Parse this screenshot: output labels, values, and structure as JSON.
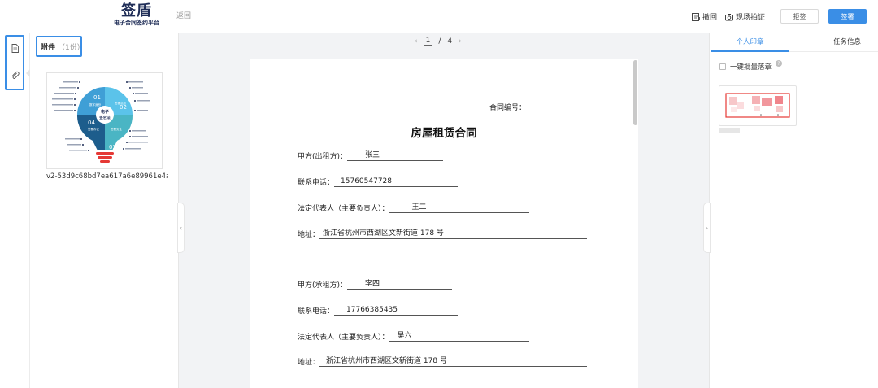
{
  "header": {
    "logo_main": "签盾",
    "logo_sub": "电子合同签约平台",
    "back_label": "返回",
    "withdraw_label": "撤回",
    "photo_verify_label": "现场拍证",
    "reject_label": "拒签",
    "sign_label": "签署"
  },
  "attachments": {
    "title": "附件",
    "count": "（1份）",
    "file_name": "v2-53d9c68bd7ea617a6e89961e4a..."
  },
  "pager": {
    "current": "1",
    "separator": "/",
    "total": "4"
  },
  "contract": {
    "number_label": "合同编号：",
    "title": "房屋租赁合同",
    "fields": [
      {
        "label": "甲方(出租方)：",
        "value": "张三"
      },
      {
        "label": "联系电话：",
        "value": "15760547728"
      },
      {
        "label": "法定代表人（主要负责人）：",
        "value": "王二"
      },
      {
        "label": "地址：",
        "value": "浙江省杭州市西湖区文新街道 178 号"
      },
      {
        "label": "甲方(承租方)：",
        "value": "李四"
      },
      {
        "label": "联系电话：",
        "value": "17766385435"
      },
      {
        "label": "法定代表人（主要负责人）：",
        "value": "吴六"
      },
      {
        "label": "地址：",
        "value": "浙江省杭州市西湖区文新街道 178 号"
      }
    ]
  },
  "thumbnail": {
    "center_label_1": "电子",
    "center_label_2": "签名法",
    "segments": [
      {
        "num": "01",
        "label": "数字身份"
      },
      {
        "num": "02",
        "label": "签署意愿"
      },
      {
        "num": "03",
        "label": "签署安全"
      },
      {
        "num": "04",
        "label": "签署存证"
      }
    ]
  },
  "right_panel": {
    "tab_personal_seal": "个人印章",
    "tab_task_info": "任务信息",
    "batch_seal_label": "一键批量落章",
    "help_mark": "?"
  },
  "colors": {
    "accent": "#3a8ee6",
    "seal_red": "#e53935",
    "brand_navy": "#1f2d57"
  }
}
